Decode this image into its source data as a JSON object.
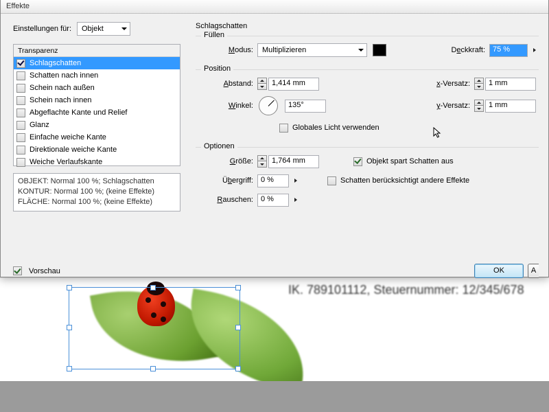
{
  "title": "Effekte",
  "settings_for_label": "Einstellungen für:",
  "settings_for_value": "Objekt",
  "fx_tab": "Transparenz",
  "fx_items": [
    {
      "label": "Schlagschatten",
      "checked": true,
      "selected": true
    },
    {
      "label": "Schatten nach innen",
      "checked": false
    },
    {
      "label": "Schein nach außen",
      "checked": false
    },
    {
      "label": "Schein nach innen",
      "checked": false
    },
    {
      "label": "Abgeflachte Kante und Relief",
      "checked": false
    },
    {
      "label": "Glanz",
      "checked": false
    },
    {
      "label": "Einfache weiche Kante",
      "checked": false
    },
    {
      "label": "Direktionale weiche Kante",
      "checked": false
    },
    {
      "label": "Weiche Verlaufskante",
      "checked": false
    }
  ],
  "summary": {
    "l1": "OBJEKT: Normal 100 %; Schlagschatten",
    "l2": "KONTUR: Normal 100 %; (keine Effekte)",
    "l3": "FLÄCHE: Normal 100 %; (keine Effekte)"
  },
  "preview_label": "Vorschau",
  "panel_title": "Schlagschatten",
  "fill": {
    "legend": "Füllen",
    "mode_label": "Modus:",
    "mode_value": "Multiplizieren",
    "opacity_label": "Deckkraft:",
    "opacity_value": "75 %"
  },
  "position": {
    "legend": "Position",
    "distance_label": "Abstand:",
    "distance_value": "1,414 mm",
    "angle_label": "Winkel:",
    "angle_value": "135°",
    "global_light": "Globales Licht verwenden",
    "x_label": "x-Versatz:",
    "x_value": "1 mm",
    "y_label": "y-Versatz:",
    "y_value": "1 mm"
  },
  "options": {
    "legend": "Optionen",
    "size_label": "Größe:",
    "size_value": "1,764 mm",
    "spread_label": "Übergriff:",
    "spread_value": "0 %",
    "noise_label": "Rauschen:",
    "noise_value": "0 %",
    "knockout": "Objekt spart Schatten aus",
    "honors": "Schatten berücksichtigt andere Effekte"
  },
  "ok": "OK",
  "bg_text": "IK. 789101112, Steuernummer: 12/345/678"
}
